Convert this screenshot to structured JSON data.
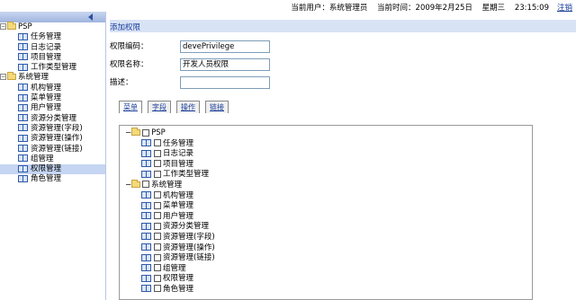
{
  "topbar": {
    "current_user": "当前用户：系统管理员",
    "current_time": "当前时间：2009年2月25日",
    "weekday": "星期三",
    "clock": "23:15:09",
    "logout": "注销"
  },
  "sidebar": {
    "groups": [
      {
        "label": "PSP",
        "items": [
          "任务管理",
          "日志记录",
          "项目管理",
          "工作类型管理"
        ]
      },
      {
        "label": "系统管理",
        "items": [
          "机构管理",
          "菜单管理",
          "用户管理",
          "资源分类管理",
          "资源管理(字段)",
          "资源管理(操作)",
          "资源管理(链接)",
          "组管理",
          "权限管理",
          "角色管理"
        ]
      }
    ],
    "selected": "权限管理"
  },
  "main": {
    "title": "添加权限",
    "form": {
      "code_label": "权限编码：",
      "code_value": "devePrivilege",
      "name_label": "权限名称：",
      "name_value": "开发人员权限",
      "desc_label": "描述：",
      "desc_value": ""
    },
    "tabs": [
      "菜单",
      "字段",
      "操作",
      "链接"
    ],
    "tree": [
      {
        "label": "PSP",
        "items": [
          "任务管理",
          "日志记录",
          "项目管理",
          "工作类型管理"
        ]
      },
      {
        "label": "系统管理",
        "items": [
          "机构管理",
          "菜单管理",
          "用户管理",
          "资源分类管理",
          "资源管理(字段)",
          "资源管理(操作)",
          "资源管理(链接)",
          "组管理",
          "权限管理",
          "角色管理"
        ]
      }
    ]
  }
}
